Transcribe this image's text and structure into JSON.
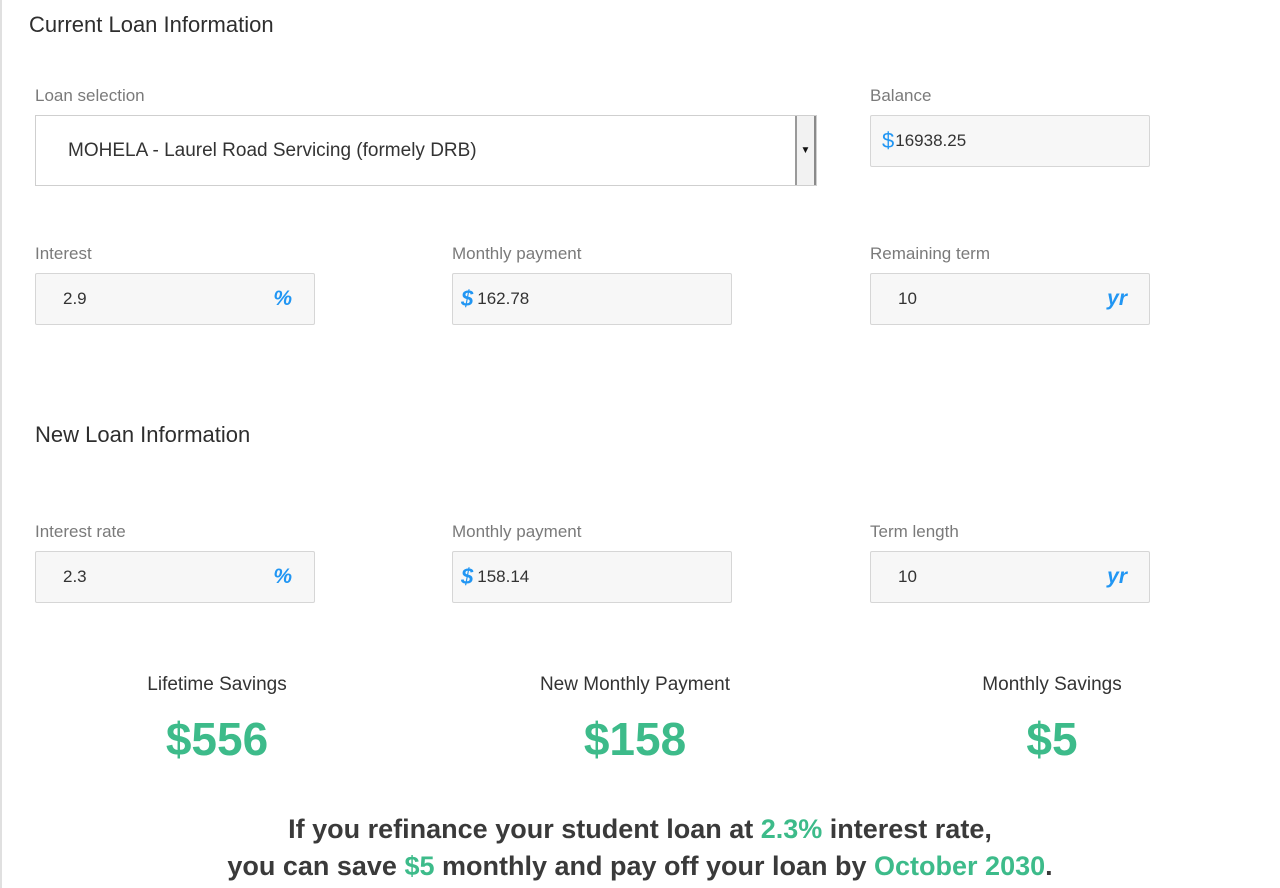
{
  "current": {
    "title": "Current Loan Information",
    "loan_selection": {
      "label": "Loan selection",
      "value": "MOHELA - Laurel Road Servicing (formely DRB)"
    },
    "balance": {
      "label": "Balance",
      "currency": "$",
      "value": "16938.25"
    },
    "interest": {
      "label": "Interest",
      "value": "2.9",
      "suffix": "%"
    },
    "monthly_payment": {
      "label": "Monthly payment",
      "currency": "$",
      "value": "162.78"
    },
    "remaining_term": {
      "label": "Remaining term",
      "value": "10",
      "suffix": "yr"
    }
  },
  "new_loan": {
    "title": "New Loan Information",
    "interest_rate": {
      "label": "Interest rate",
      "value": "2.3",
      "suffix": "%"
    },
    "monthly_payment": {
      "label": "Monthly payment",
      "currency": "$",
      "value": "158.14"
    },
    "term_length": {
      "label": "Term length",
      "value": "10",
      "suffix": "yr"
    }
  },
  "summary": {
    "lifetime_savings": {
      "label": "Lifetime Savings",
      "value": "$556"
    },
    "new_monthly_payment": {
      "label": "New Monthly Payment",
      "value": "$158"
    },
    "monthly_savings": {
      "label": "Monthly Savings",
      "value": "$5"
    }
  },
  "message": {
    "line1_pre": "If you refinance your student loan at ",
    "rate": "2.3%",
    "line1_post": " interest rate,",
    "line2_pre": "you can save ",
    "savings": "$5",
    "line2_mid": " monthly and pay off your loan by ",
    "payoff_date": "October 2030",
    "line2_post": "."
  },
  "colors": {
    "accent_blue": "#2196f3",
    "highlight_green": "#3dbb8a"
  }
}
